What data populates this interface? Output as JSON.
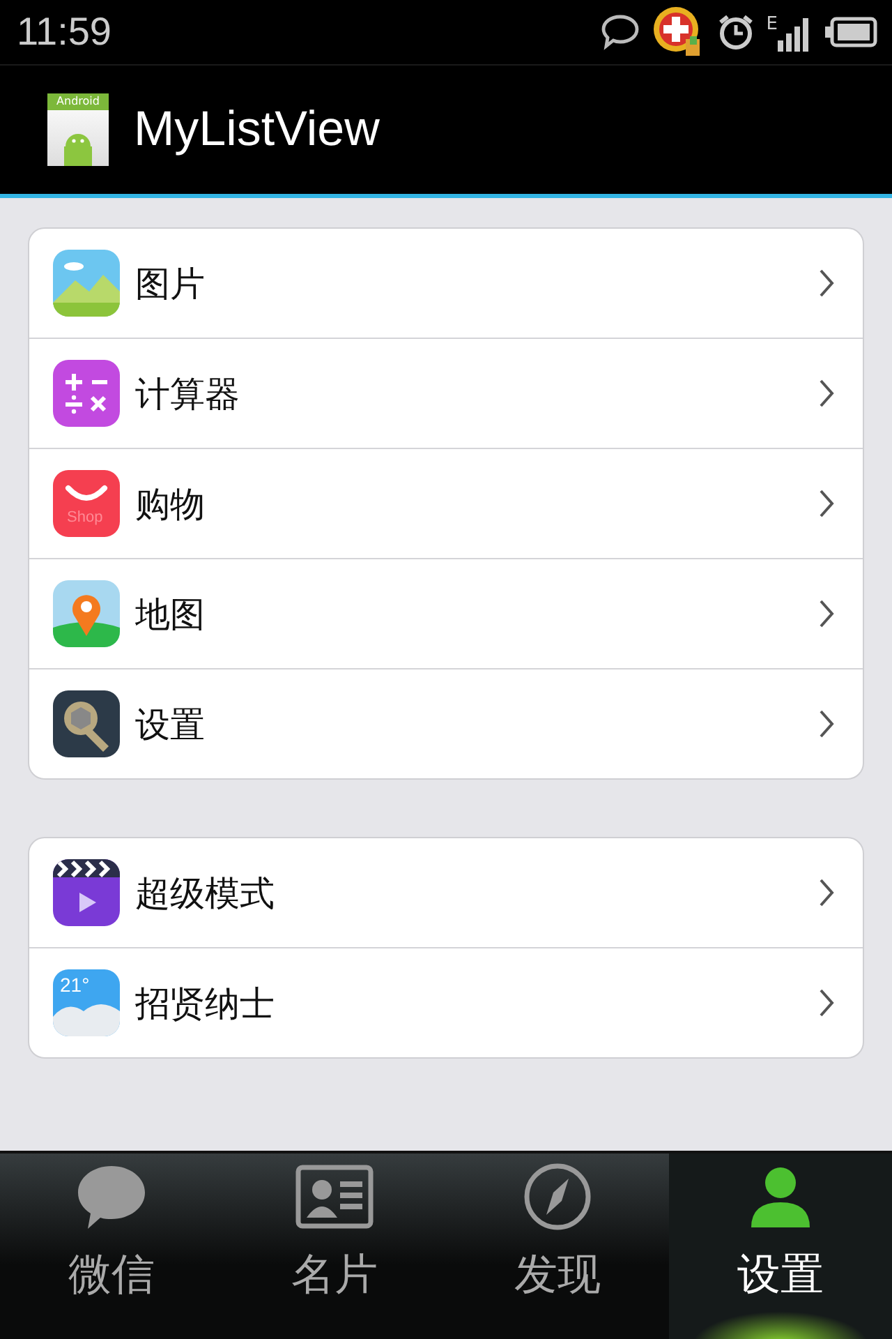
{
  "status_bar": {
    "time": "11:59",
    "network": "E"
  },
  "app_bar": {
    "title": "MyListView",
    "icon_text": "Android"
  },
  "groups": [
    {
      "items": [
        {
          "kind": "gallery",
          "label": "图片"
        },
        {
          "kind": "calculator",
          "label": "计算器"
        },
        {
          "kind": "shop",
          "label": "购物",
          "icon_text": "Shop"
        },
        {
          "kind": "map",
          "label": "地图"
        },
        {
          "kind": "settings",
          "label": "设置"
        }
      ]
    },
    {
      "items": [
        {
          "kind": "video",
          "label": "超级模式"
        },
        {
          "kind": "weather",
          "label": "招贤纳士",
          "icon_text": "21°"
        }
      ]
    }
  ],
  "tabs": [
    {
      "kind": "chat",
      "label": "微信",
      "selected": false
    },
    {
      "kind": "card",
      "label": "名片",
      "selected": false
    },
    {
      "kind": "compass",
      "label": "发现",
      "selected": false
    },
    {
      "kind": "person",
      "label": "设置",
      "selected": true
    }
  ]
}
